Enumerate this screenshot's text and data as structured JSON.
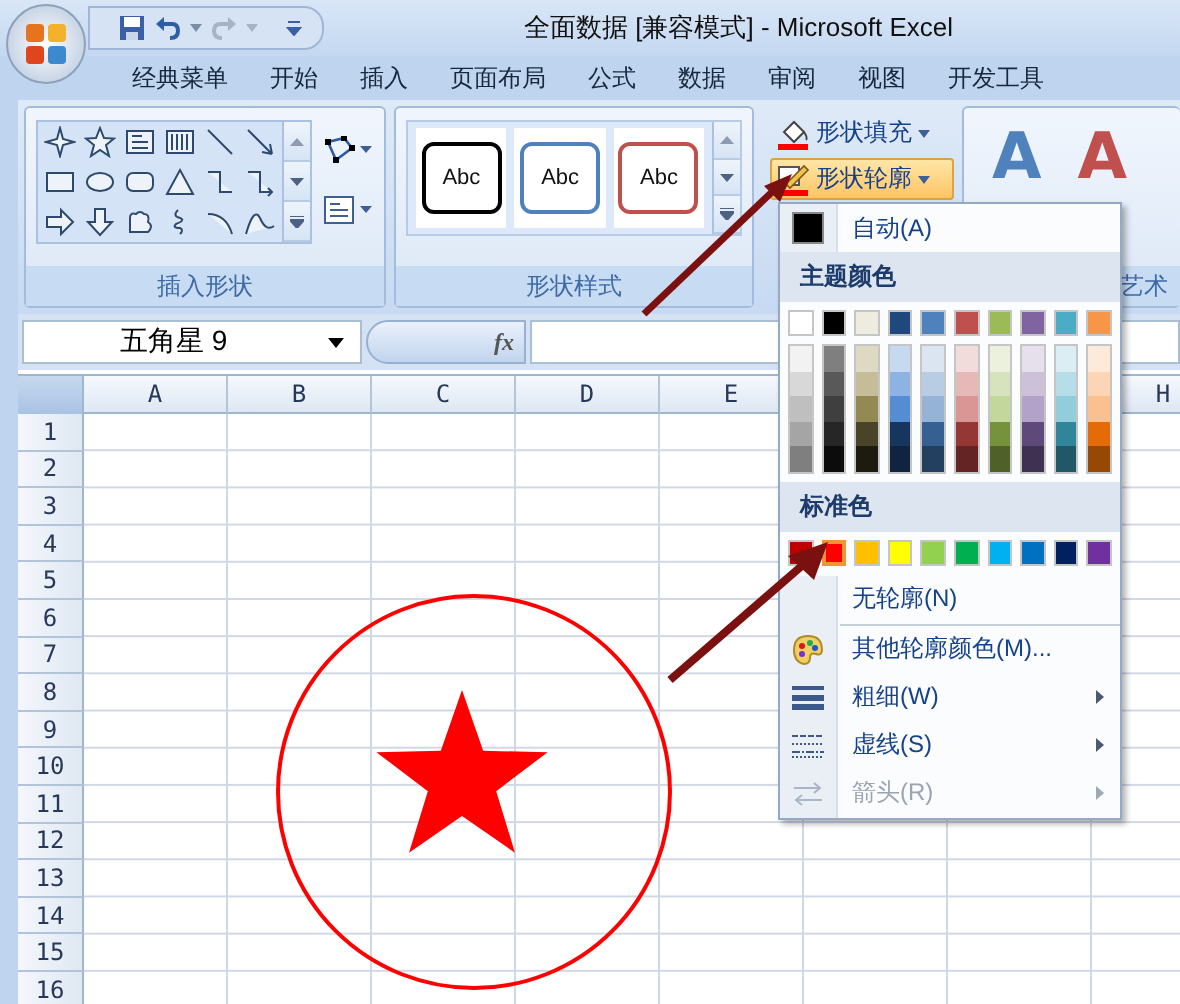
{
  "window": {
    "title": "全面数据  [兼容模式] - Microsoft Excel"
  },
  "tabs": [
    {
      "label": "经典菜单",
      "selected": false
    },
    {
      "label": "开始",
      "selected": false
    },
    {
      "label": "插入",
      "selected": false
    },
    {
      "label": "页面布局",
      "selected": false
    },
    {
      "label": "公式",
      "selected": false
    },
    {
      "label": "数据",
      "selected": false
    },
    {
      "label": "审阅",
      "selected": false
    },
    {
      "label": "视图",
      "selected": false
    },
    {
      "label": "开发工具",
      "selected": false
    }
  ],
  "ribbon": {
    "insert_shapes": {
      "label": "插入形状"
    },
    "shape_styles": {
      "label": "形状样式",
      "styles": [
        {
          "label": "Abc",
          "color": "#000000"
        },
        {
          "label": "Abc",
          "color": "#4f81bd"
        },
        {
          "label": "Abc",
          "color": "#c0504d"
        }
      ]
    },
    "shape_commands": [
      {
        "label": "形状填充",
        "expanded": false
      },
      {
        "label": "形状轮廓",
        "expanded": true
      }
    ],
    "wordart": {
      "label": "艺术",
      "letters": [
        {
          "label": "A",
          "color": "#4f81bd"
        },
        {
          "label": "A",
          "color": "#c0504d"
        }
      ]
    }
  },
  "formula_bar": {
    "name_box": "五角星 9",
    "fx": "fx"
  },
  "sheet": {
    "columns": [
      "A",
      "B",
      "C",
      "D",
      "E",
      "H"
    ],
    "rows": [
      "1",
      "2",
      "3",
      "4",
      "5",
      "6",
      "7",
      "8",
      "9",
      "10",
      "11",
      "12",
      "13",
      "14",
      "15",
      "16"
    ]
  },
  "outline_menu": {
    "automatic": {
      "label": "自动(A)"
    },
    "theme_header": "主题颜色",
    "theme_colors": [
      {
        "color": "#ffffff",
        "shades": [
          {
            "color": "#f2f2f2"
          },
          {
            "color": "#d8d8d8"
          },
          {
            "color": "#bfbfbf"
          },
          {
            "color": "#a5a5a5"
          },
          {
            "color": "#7f7f7f"
          }
        ]
      },
      {
        "color": "#000000",
        "shades": [
          {
            "color": "#7f7f7f"
          },
          {
            "color": "#595959"
          },
          {
            "color": "#3f3f3f"
          },
          {
            "color": "#262626"
          },
          {
            "color": "#0c0c0c"
          }
        ]
      },
      {
        "color": "#eeece1",
        "shades": [
          {
            "color": "#ddd9c3"
          },
          {
            "color": "#c4bd97"
          },
          {
            "color": "#938953"
          },
          {
            "color": "#494429"
          },
          {
            "color": "#1d1b10"
          }
        ]
      },
      {
        "color": "#1f497d",
        "shades": [
          {
            "color": "#c6d9f0"
          },
          {
            "color": "#8db3e2"
          },
          {
            "color": "#548dd4"
          },
          {
            "color": "#17365d"
          },
          {
            "color": "#0f243e"
          }
        ]
      },
      {
        "color": "#4f81bd",
        "shades": [
          {
            "color": "#dbe5f1"
          },
          {
            "color": "#b8cce4"
          },
          {
            "color": "#95b3d7"
          },
          {
            "color": "#366092"
          },
          {
            "color": "#244061"
          }
        ]
      },
      {
        "color": "#c0504d",
        "shades": [
          {
            "color": "#f2dcdb"
          },
          {
            "color": "#e5b9b7"
          },
          {
            "color": "#d99694"
          },
          {
            "color": "#953734"
          },
          {
            "color": "#632423"
          }
        ]
      },
      {
        "color": "#9bbb59",
        "shades": [
          {
            "color": "#ebf1dd"
          },
          {
            "color": "#d7e3bc"
          },
          {
            "color": "#c3d69b"
          },
          {
            "color": "#76923c"
          },
          {
            "color": "#4f6128"
          }
        ]
      },
      {
        "color": "#8064a2",
        "shades": [
          {
            "color": "#e5e0ec"
          },
          {
            "color": "#ccc1d9"
          },
          {
            "color": "#b2a2c7"
          },
          {
            "color": "#5f497a"
          },
          {
            "color": "#3f3151"
          }
        ]
      },
      {
        "color": "#4bacc6",
        "shades": [
          {
            "color": "#dbeef3"
          },
          {
            "color": "#b7dde8"
          },
          {
            "color": "#92cddc"
          },
          {
            "color": "#31859b"
          },
          {
            "color": "#205867"
          }
        ]
      },
      {
        "color": "#f79646",
        "shades": [
          {
            "color": "#fdeada"
          },
          {
            "color": "#fbd5b5"
          },
          {
            "color": "#fac08f"
          },
          {
            "color": "#e36c09"
          },
          {
            "color": "#974806"
          }
        ]
      }
    ],
    "standard_header": "标准色",
    "standard_colors": [
      {
        "color": "#c00000",
        "selected": false
      },
      {
        "color": "#ff0000",
        "selected": true
      },
      {
        "color": "#ffc000",
        "selected": false
      },
      {
        "color": "#ffff00",
        "selected": false
      },
      {
        "color": "#92d050",
        "selected": false
      },
      {
        "color": "#00b050",
        "selected": false
      },
      {
        "color": "#00b0f0",
        "selected": false
      },
      {
        "color": "#0070c0",
        "selected": false
      },
      {
        "color": "#002060",
        "selected": false
      },
      {
        "color": "#7030a0",
        "selected": false
      }
    ],
    "items": [
      {
        "kind": "none",
        "label": "无轮廓(N)",
        "disabled": false,
        "submenu": false
      },
      {
        "kind": "more",
        "label": "其他轮廓颜色(M)...",
        "disabled": false,
        "submenu": false
      },
      {
        "kind": "weight",
        "label": "粗细(W)",
        "disabled": false,
        "submenu": true
      },
      {
        "kind": "dash",
        "label": "虚线(S)",
        "disabled": false,
        "submenu": true
      },
      {
        "kind": "arrows",
        "label": "箭头(R)",
        "disabled": true,
        "submenu": true
      }
    ]
  }
}
